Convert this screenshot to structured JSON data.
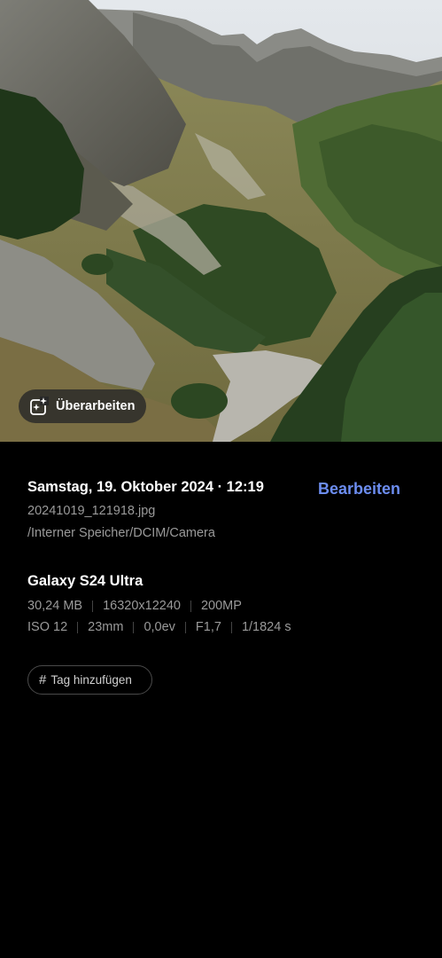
{
  "photo": {
    "edit_button_label": "Überarbeiten"
  },
  "details": {
    "date_time": "Samstag, 19. Oktober 2024 · 12:19",
    "edit_label": "Bearbeiten",
    "filename": "20241019_121918.jpg",
    "path": "/Interner Speicher/DCIM/Camera",
    "device": "Galaxy S24 Ultra",
    "file_size": "30,24 MB",
    "resolution": "16320x12240",
    "megapixels": "200MP",
    "iso": "ISO 12",
    "focal_length": "23mm",
    "exposure_value": "0,0ev",
    "aperture": "F1,7",
    "shutter_speed": "1/1824 s",
    "tag_label": "Tag hinzufügen",
    "tag_icon": "hash-icon"
  },
  "colors": {
    "accent": "#6c8df0",
    "background": "#000000",
    "secondary_text": "#9a9a9a"
  }
}
